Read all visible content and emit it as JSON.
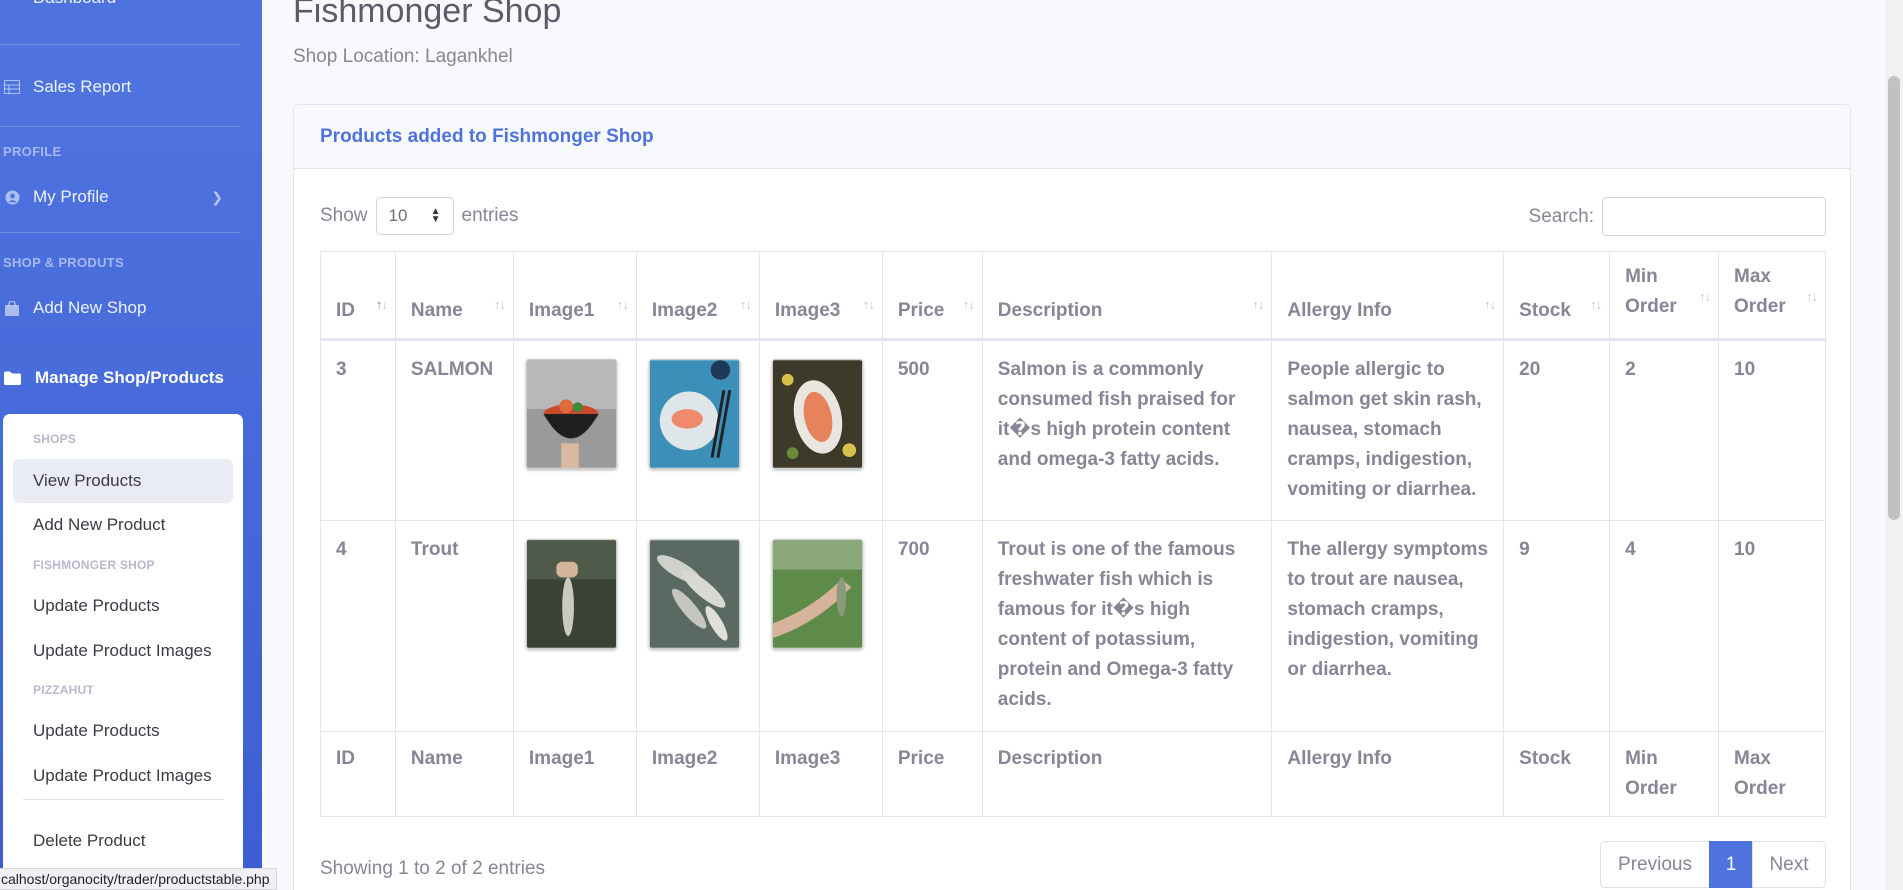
{
  "sidebar": {
    "dashboard_label": "Dashboard",
    "sales_report_label": "Sales Report",
    "profile_heading": "PROFILE",
    "my_profile_label": "My Profile",
    "shop_heading": "SHOP & PRODUTS",
    "add_new_shop_label": "Add New Shop",
    "manage_label": "Manage Shop/Products",
    "submenu": {
      "shops_heading": "SHOPS",
      "view_products": "View Products",
      "add_new_product": "Add New Product",
      "fishmonger_heading": "FISHMONGER SHOP",
      "fish_update_products": "Update Products",
      "fish_update_images": "Update Product Images",
      "pizzahut_heading": "PIZZAHUT",
      "pizza_update_products": "Update Products",
      "pizza_update_images": "Update Product Images",
      "delete_product": "Delete Product"
    }
  },
  "status_url": "calhost/organocity/trader/productstable.php",
  "page": {
    "title": "Fishmonger Shop",
    "subtitle": "Shop Location: Lagankhel"
  },
  "card": {
    "header": "Products added to Fishmonger Shop",
    "show_label": "Show",
    "entries_value": "10",
    "entries_label": "entries",
    "search_label": "Search:"
  },
  "table": {
    "headers": {
      "id": "ID",
      "name": "Name",
      "image1": "Image1",
      "image2": "Image2",
      "image3": "Image3",
      "price": "Price",
      "description": "Description",
      "allergy": "Allergy Info",
      "stock": "Stock",
      "min_order": "Min Order",
      "max_order": "Max Order"
    },
    "rows": [
      {
        "id": "3",
        "name": "SALMON",
        "price": "500",
        "description": "Salmon is a commonly consumed fish praised for it�s high protein content and omega-3 fatty acids.",
        "allergy": "People allergic to salmon get skin rash, nausea, stomach cramps, indigestion, vomiting or diarrhea.",
        "stock": "20",
        "min_order": "2",
        "max_order": "10"
      },
      {
        "id": "4",
        "name": "Trout",
        "price": "700",
        "description": "Trout is one of the famous freshwater fish which is famous for it�s high content of potassium, protein and Omega-3 fatty acids.",
        "allergy": "The allergy symptoms to trout are nausea, stomach cramps, indigestion, vomiting or diarrhea.",
        "stock": "9",
        "min_order": "4",
        "max_order": "10"
      }
    ]
  },
  "footer": {
    "info": "Showing 1 to 2 of 2 entries",
    "previous": "Previous",
    "page": "1",
    "next": "Next"
  }
}
